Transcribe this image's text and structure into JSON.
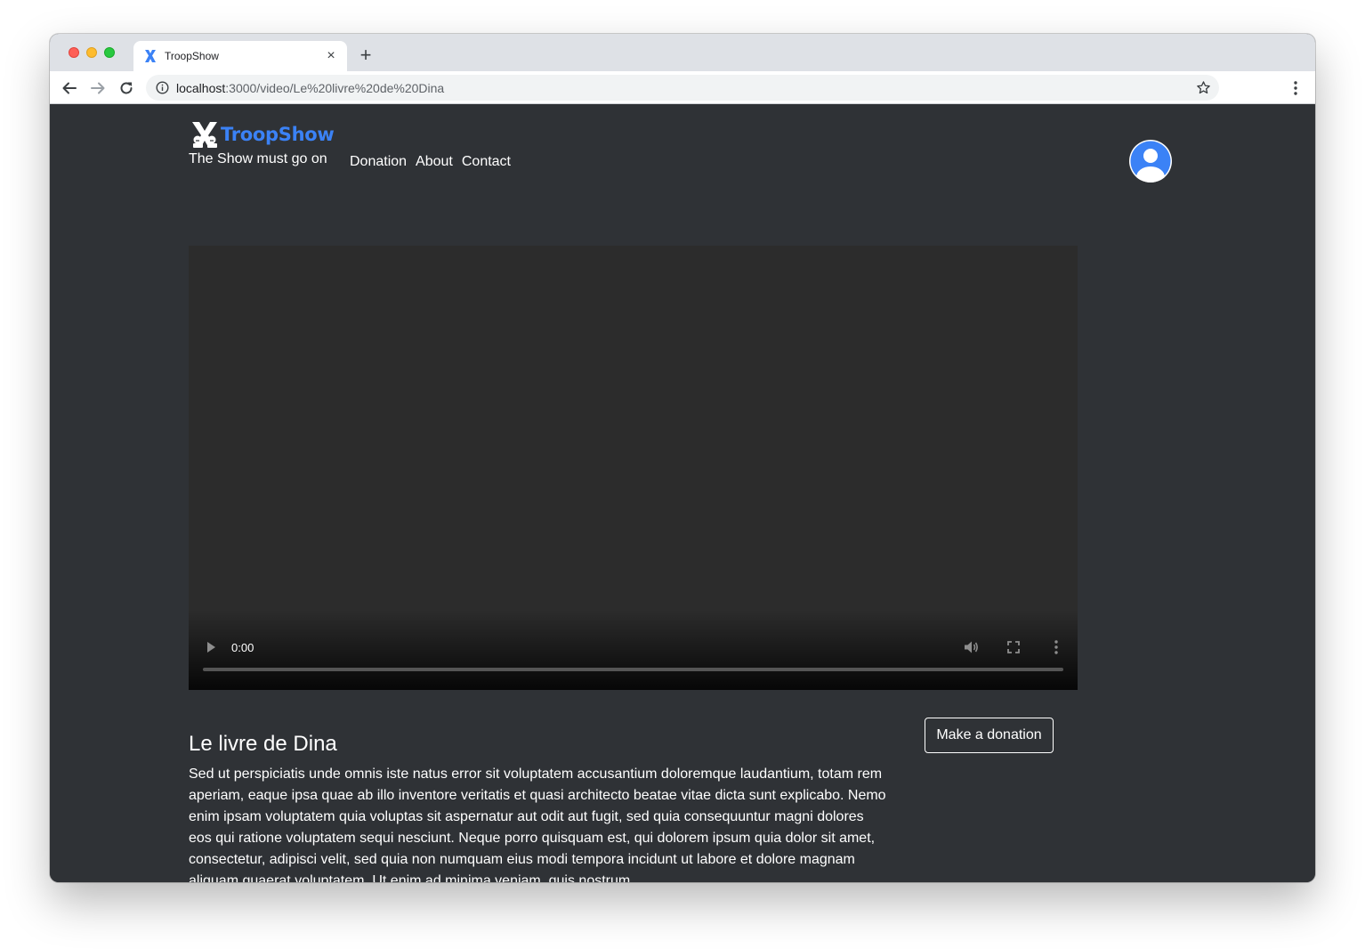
{
  "browser": {
    "tab_title": "TroopShow",
    "tab_close": "×",
    "new_tab": "+",
    "url_host": "localhost",
    "url_path": ":3000/video/Le%20livre%20de%20Dina"
  },
  "header": {
    "brand_name": "TroopShow",
    "tagline": "The Show must go on",
    "nav": [
      {
        "label": "Donation"
      },
      {
        "label": "About"
      },
      {
        "label": "Contact"
      }
    ]
  },
  "video_player": {
    "current_time": "0:00",
    "progress": 0
  },
  "video": {
    "title": "Le livre de Dina",
    "description": "Sed ut perspiciatis unde omnis iste natus error sit voluptatem accusantium doloremque laudantium, totam rem aperiam, eaque ipsa quae ab illo inventore veritatis et quasi architecto beatae vitae dicta sunt explicabo. Nemo enim ipsam voluptatem quia voluptas sit aspernatur aut odit aut fugit, sed quia consequuntur magni dolores eos qui ratione voluptatem sequi nesciunt. Neque porro quisquam est, qui dolorem ipsum quia dolor sit amet, consectetur, adipisci velit, sed quia non numquam eius modi tempora incidunt ut labore et dolore magnam aliquam quaerat voluptatem. Ut enim ad minima veniam, quis nostrum",
    "donate_label": "Make a donation"
  },
  "colors": {
    "page_background": "#2f3236",
    "brand_accent": "#3b82f6",
    "video_background": "#2c2c2c"
  },
  "icons": {
    "tab_favicon": "troopshow-logo-icon",
    "back": "arrow-left-icon",
    "forward": "arrow-right-icon",
    "reload": "reload-icon",
    "site_info": "info-icon",
    "bookmark": "star-icon",
    "browser_menu": "vertical-dots-icon",
    "avatar": "user-avatar-icon",
    "play": "play-icon",
    "volume": "volume-icon",
    "fullscreen": "fullscreen-icon",
    "more": "vertical-dots-icon"
  }
}
